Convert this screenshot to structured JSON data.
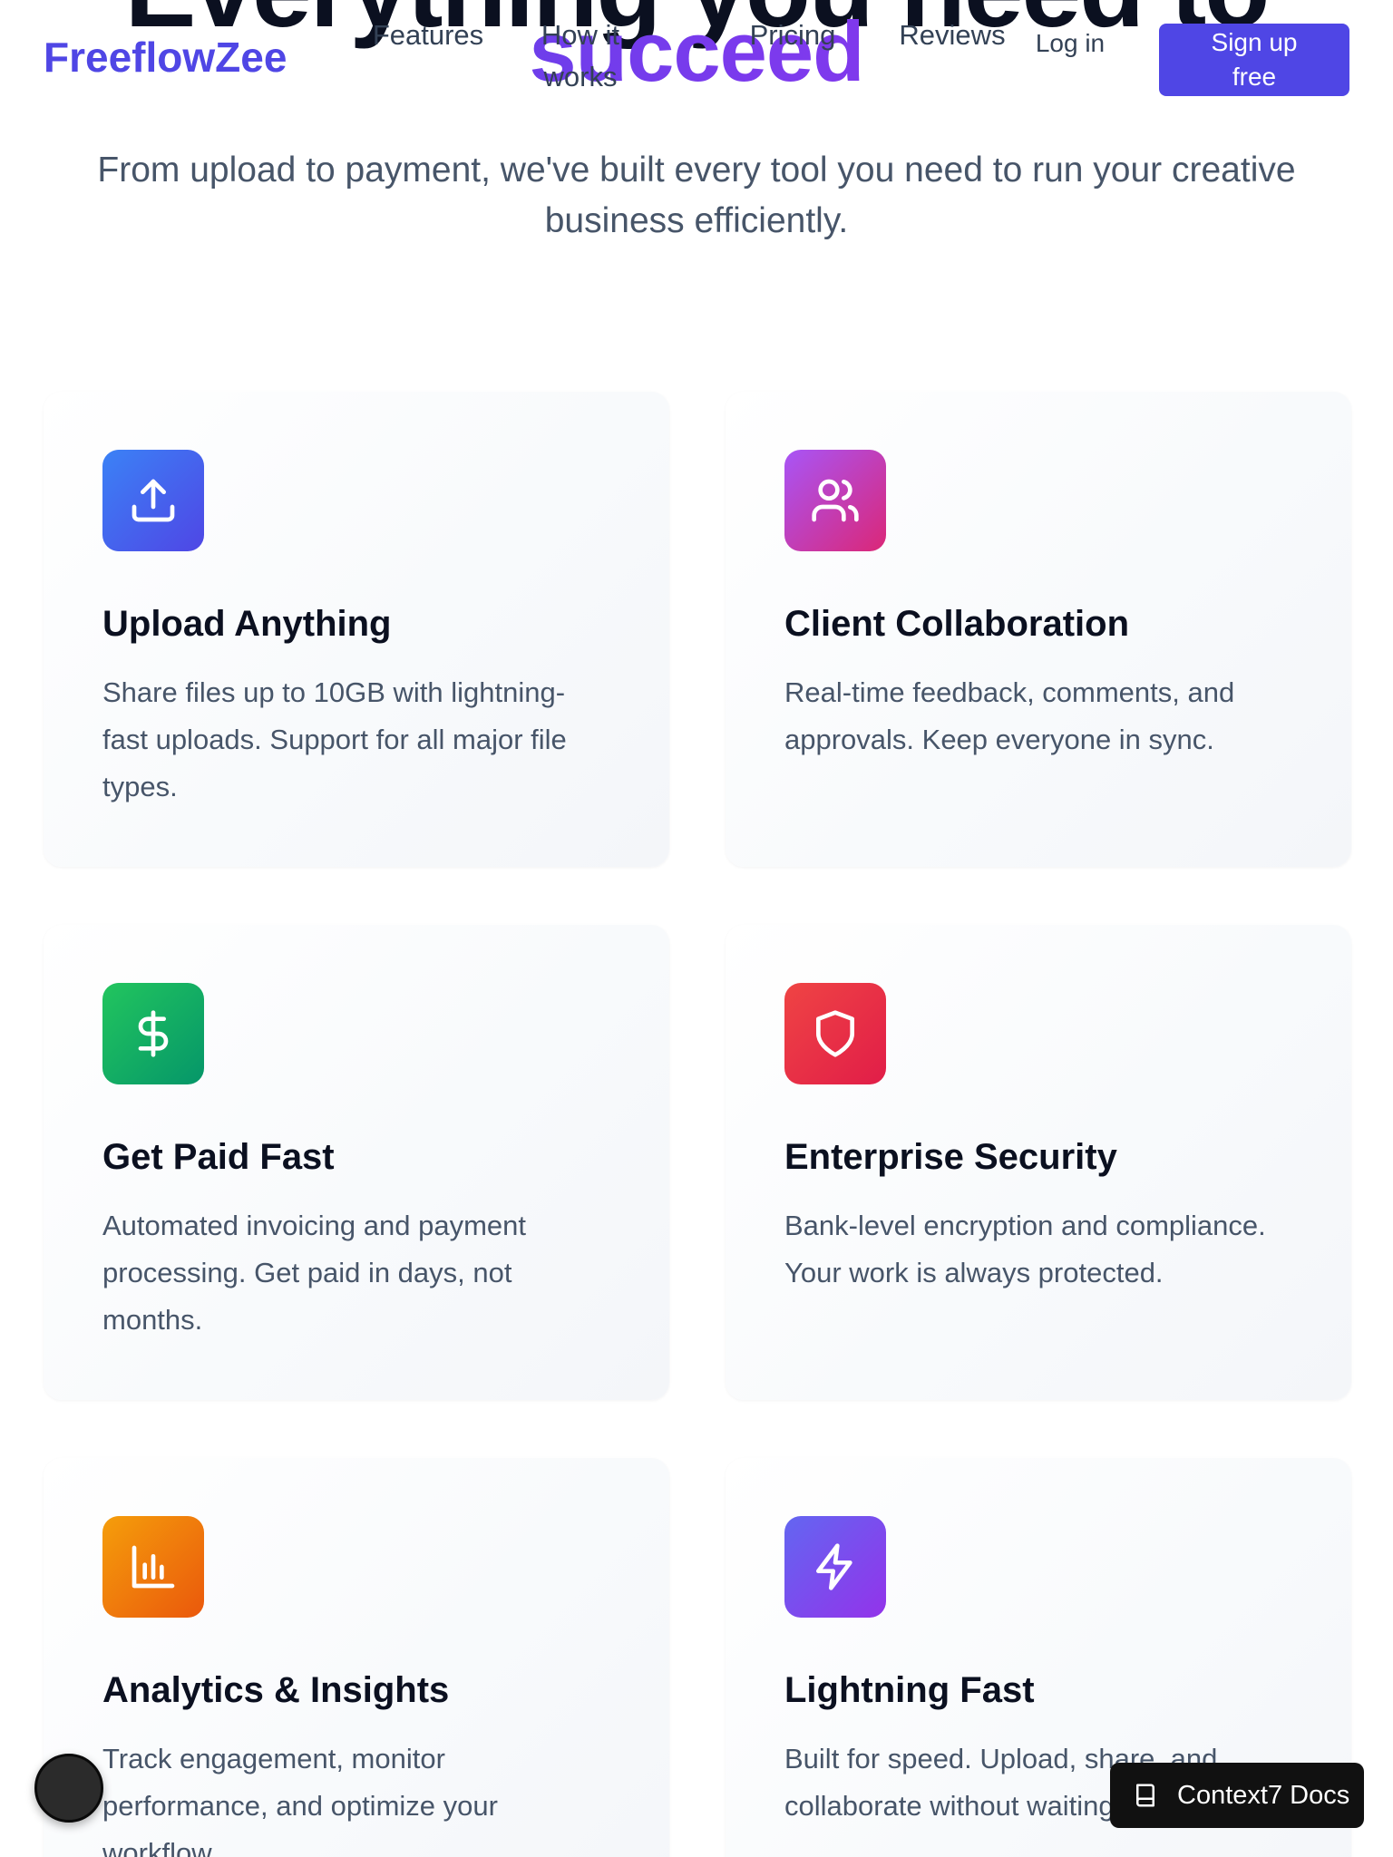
{
  "hero": {
    "heading_top": "Everything you need to",
    "heading_accent": "succeed",
    "subtitle": "From upload to payment, we've built every tool you need to run your creative business efficiently."
  },
  "header": {
    "logo": "FreeflowZee",
    "nav": {
      "features": "Features",
      "how_it_works": "How it works",
      "pricing": "Pricing",
      "reviews": "Reviews",
      "login": "Log in"
    },
    "signup_label": "Sign up free"
  },
  "features": [
    {
      "title": "Upload Anything",
      "description": "Share files up to 10GB with lightning-fast uploads. Support for all major file types.",
      "icon": "upload-icon",
      "gradient": [
        "#3b82f6",
        "#4f46e5"
      ]
    },
    {
      "title": "Client Collaboration",
      "description": "Real-time feedback, comments, and approvals. Keep everyone in sync.",
      "icon": "users-icon",
      "gradient": [
        "#a855f7",
        "#db2777"
      ]
    },
    {
      "title": "Get Paid Fast",
      "description": "Automated invoicing and payment processing. Get paid in days, not months.",
      "icon": "dollar-icon",
      "gradient": [
        "#22c55e",
        "#059669"
      ]
    },
    {
      "title": "Enterprise Security",
      "description": "Bank-level encryption and compliance. Your work is always protected.",
      "icon": "shield-icon",
      "gradient": [
        "#ef4444",
        "#e11d48"
      ]
    },
    {
      "title": "Analytics & Insights",
      "description": "Track engagement, monitor performance, and optimize your workflow.",
      "icon": "bar-chart-icon",
      "gradient": [
        "#f59e0b",
        "#ea580c"
      ]
    },
    {
      "title": "Lightning Fast",
      "description": "Built for speed. Upload, share, and collaborate without waiting.",
      "icon": "lightning-icon",
      "gradient": [
        "#6366f1",
        "#9333ea"
      ]
    }
  ],
  "widgets": {
    "docs_button_label": "Context7 Docs"
  }
}
